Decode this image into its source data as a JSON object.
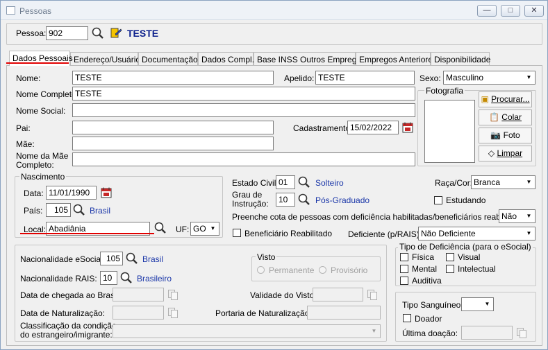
{
  "window": {
    "title": "Pessoas"
  },
  "header": {
    "pessoa_label": "Pessoa:",
    "pessoa_code": "902",
    "pessoa_name": "TESTE"
  },
  "tabs": [
    {
      "label": "Dados Pessoais"
    },
    {
      "label": "Endereço/Usuário"
    },
    {
      "label": "Documentação"
    },
    {
      "label": "Dados Compl."
    },
    {
      "label": "Base INSS Outros Empregos"
    },
    {
      "label": "Empregos Anteriores"
    },
    {
      "label": "Disponibilidade"
    }
  ],
  "dados": {
    "nome_label": "Nome:",
    "nome": "TESTE",
    "apelido_label": "Apelido:",
    "apelido": "TESTE",
    "sexo_label": "Sexo:",
    "sexo": "Masculino",
    "nome_completo_label": "Nome Completo:",
    "nome_completo": "TESTE",
    "nome_social_label": "Nome Social:",
    "nome_social": "",
    "pai_label": "Pai:",
    "pai": "",
    "cadastramento_label": "Cadastramento:",
    "cadastramento": "15/02/2022",
    "mae_label": "Mãe:",
    "mae": "",
    "nome_mae_completo_label_1": "Nome da Mãe",
    "nome_mae_completo_label_2": "Completo:",
    "nome_mae_completo": "",
    "fotografia_label": "Fotografia",
    "procurar_label": "Procurar...",
    "colar_label": "Colar",
    "foto_label": "Foto",
    "limpar_label": "Limpar"
  },
  "nascimento": {
    "group_label": "Nascimento",
    "data_label": "Data:",
    "data": "11/01/1990",
    "pais_label": "País:",
    "pais_code": "105",
    "pais_name": "Brasil",
    "local_label": "Local:",
    "local": "Abadiânia",
    "uf_label": "UF:",
    "uf": "GO"
  },
  "civil": {
    "estado_civil_label": "Estado Civil:",
    "estado_civil_code": "01",
    "estado_civil_name": "Solteiro",
    "grau_label_1": "Grau de",
    "grau_label_2": "Instrução:",
    "grau_code": "10",
    "grau_name": "Pós-Graduado",
    "raca_label": "Raça/Cor:",
    "raca": "Branca",
    "estudando_label": "Estudando",
    "cota_label": "Preenche cota de pessoas com deficiência habilitadas/beneficiários reabilitados:",
    "cota": "Não",
    "beneficiario_label": "Beneficiário Reabilitado",
    "deficiente_label": "Deficiente (p/RAIS):",
    "deficiente": "Não Deficiente"
  },
  "estrangeiro": {
    "nac_esocial_label": "Nacionalidade eSocial:",
    "nac_esocial_code": "105",
    "nac_esocial_name": "Brasil",
    "nac_rais_label": "Nacionalidade RAIS:",
    "nac_rais_code": "10",
    "nac_rais_name": "Brasileiro",
    "chegada_label": "Data de chegada ao Brasil:",
    "naturalizacao_label": "Data de Naturalização:",
    "classificacao_label_1": "Classificação da condição",
    "classificacao_label_2": "do estrangeiro/imigrante:",
    "visto_label": "Visto",
    "permanente_label": "Permanente",
    "provisorio_label": "Provisório",
    "validade_label": "Validade do Visto:",
    "portaria_label": "Portaria de Naturalização:"
  },
  "deficiencia": {
    "group_label": "Tipo de Deficiência (para o eSocial)",
    "fisica": "Física",
    "visual": "Visual",
    "mental": "Mental",
    "intelectual": "Intelectual",
    "auditiva": "Auditiva"
  },
  "sangue": {
    "tipo_label": "Tipo Sanguíneo:",
    "tipo": "",
    "doador_label": "Doador",
    "ultima_label": "Última doação:"
  },
  "colors": {
    "link": "#1a36a8",
    "name": "#0b1f8c",
    "highlight": "#e10000"
  }
}
